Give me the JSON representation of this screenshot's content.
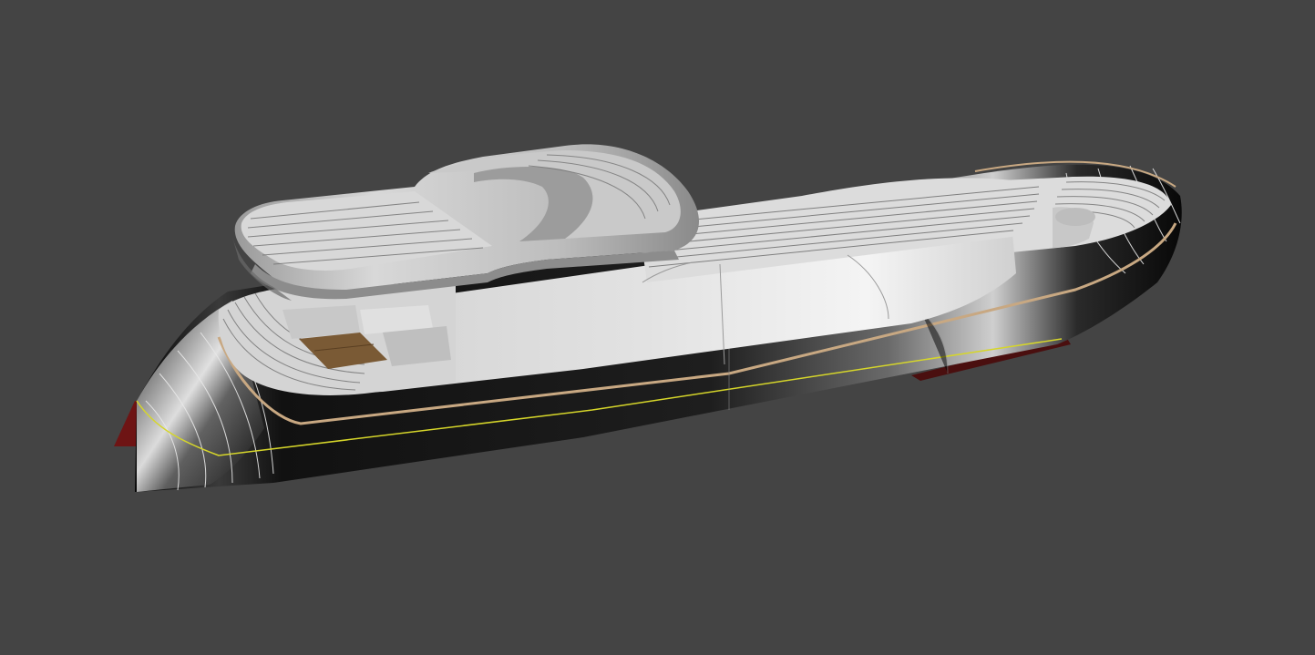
{
  "viewport": {
    "background_color": "#444444",
    "model": "yacht-hull-render"
  },
  "colors": {
    "hull": "#0d0d0d",
    "hull_highlight": "#8a8a8a",
    "superstructure": "#d9d9d9",
    "deck": "#dcdcdc",
    "deck_lines": "#6f6f6f",
    "rub_rail": "#c8a882",
    "waterline": "#d6d62a",
    "boot_stripe": "#6e1414",
    "teak": "#7a5a35",
    "section_lines": "#e8e8e8"
  }
}
